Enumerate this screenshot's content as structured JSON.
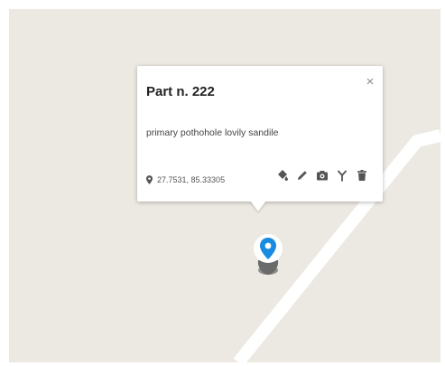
{
  "popup": {
    "title": "Part n. 222",
    "description": "primary pothohole lovily sandile",
    "coordinates": "27.7531, 85.33305",
    "close_glyph": "×",
    "actions": [
      "paint-bucket-icon",
      "pencil-icon",
      "camera-icon",
      "fork-icon",
      "trash-icon"
    ]
  },
  "colors": {
    "map_background": "#ece9e2",
    "road": "#ffffff",
    "marker": "#1a8be0",
    "icon": "#555555"
  }
}
